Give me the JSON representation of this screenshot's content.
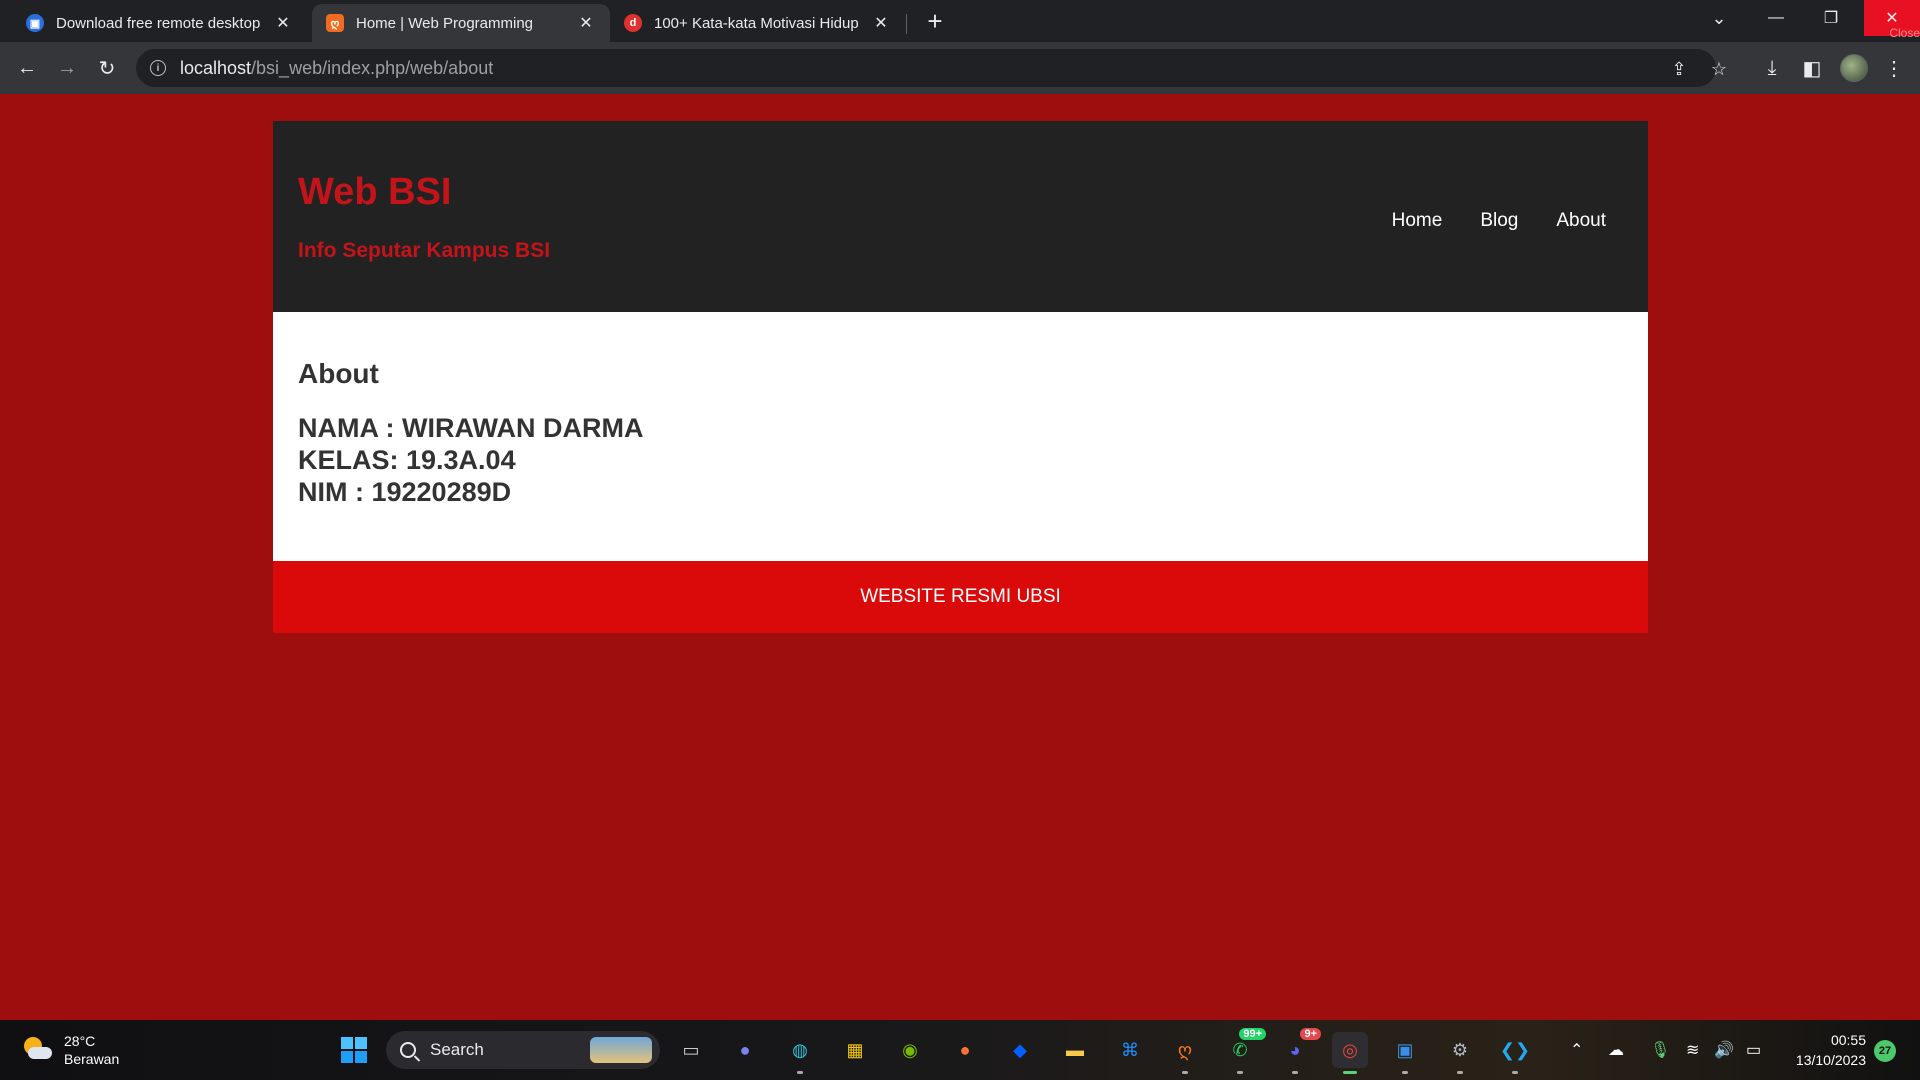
{
  "browser": {
    "tabs": [
      {
        "title": "Download free remote desktop",
        "icon": "remote-desktop-icon",
        "color": "#2a6fdb",
        "glyph": "▣"
      },
      {
        "title": "Home | Web Programming",
        "icon": "xampp-icon",
        "color": "#f26b21",
        "glyph": "ღ"
      },
      {
        "title": "100+ Kata-kata Motivasi Hidup",
        "icon": "d-site-icon",
        "color": "#e03131",
        "glyph": "d"
      }
    ],
    "url_host": "localhost",
    "url_path": "/bsi_web/index.php/web/about",
    "close_tooltip": "Close"
  },
  "site": {
    "title": "Web BSI",
    "subtitle": "Info Seputar Kampus BSI",
    "nav": [
      "Home",
      "Blog",
      "About"
    ],
    "section_heading": "About",
    "details": [
      "NAMA : WIRAWAN DARMA",
      "KELAS: 19.3A.04",
      "NIM : 19220289D"
    ],
    "footer": "WEBSITE RESMI UBSI",
    "colors": {
      "page_bg": "#9f0e0e",
      "header_bg": "#222222",
      "brand": "#c4141a",
      "footer_bg": "#da0a0a"
    }
  },
  "taskbar": {
    "weather_temp": "28°C",
    "weather_desc": "Berawan",
    "search_placeholder": "Search",
    "whatsapp_badge": "99+",
    "discord_badge": "9+",
    "clock_time": "00:55",
    "clock_date": "13/10/2023",
    "notifications": "27"
  }
}
